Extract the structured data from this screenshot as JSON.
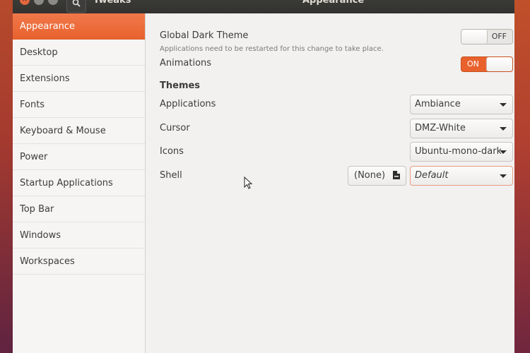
{
  "titlebar": {
    "app_title": "Tweaks",
    "page_title": "Appearance",
    "search_icon": "search-icon",
    "close_icon": "close-icon"
  },
  "sidebar": {
    "items": [
      {
        "label": "Appearance",
        "active": true
      },
      {
        "label": "Desktop"
      },
      {
        "label": "Extensions"
      },
      {
        "label": "Fonts"
      },
      {
        "label": "Keyboard & Mouse"
      },
      {
        "label": "Power"
      },
      {
        "label": "Startup Applications"
      },
      {
        "label": "Top Bar"
      },
      {
        "label": "Windows"
      },
      {
        "label": "Workspaces"
      }
    ]
  },
  "appearance": {
    "global_dark_theme": {
      "label": "Global Dark Theme",
      "subtitle": "Applications need to be restarted for this change to take place.",
      "state": "OFF"
    },
    "animations": {
      "label": "Animations",
      "state": "ON"
    },
    "themes": {
      "heading": "Themes",
      "applications": {
        "label": "Applications",
        "value": "Ambiance"
      },
      "cursor": {
        "label": "Cursor",
        "value": "DMZ-White"
      },
      "icons": {
        "label": "Icons",
        "value": "Ubuntu-mono-dark"
      },
      "shell": {
        "label": "Shell",
        "file_button": "(None)",
        "value": "Default"
      }
    }
  },
  "colors": {
    "accent": "#e9622e",
    "titlebar": "#3a3a37",
    "window_bg": "#f2f1f0"
  }
}
